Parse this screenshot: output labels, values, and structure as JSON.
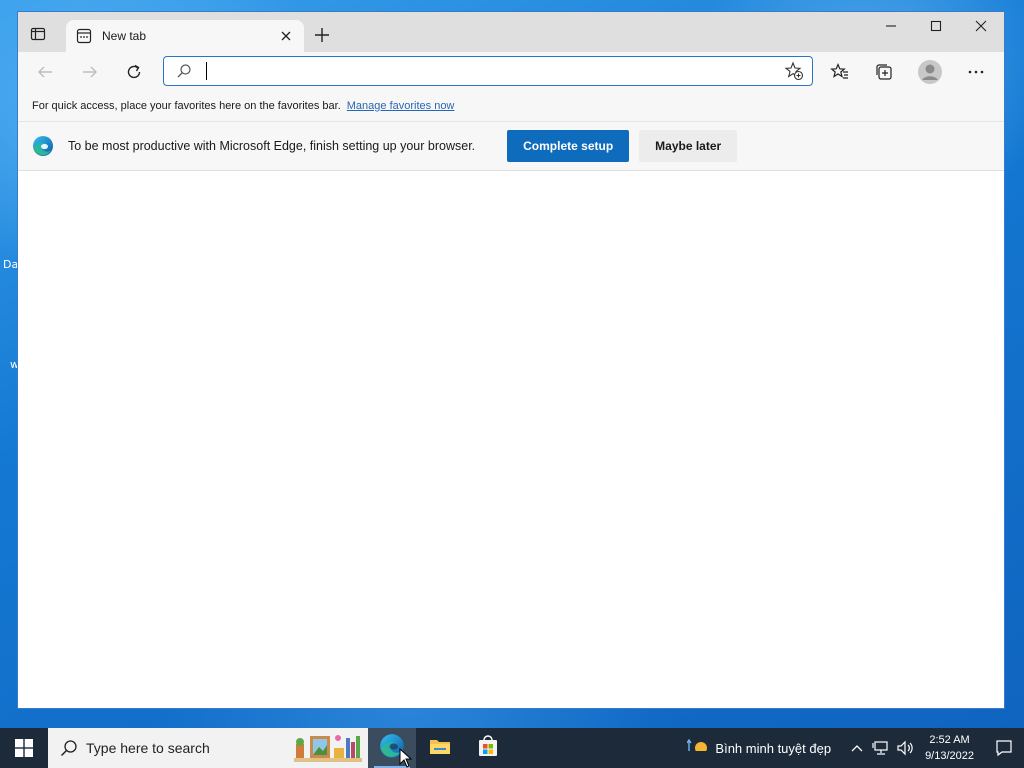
{
  "desktop": {
    "fragments": [
      "Da",
      "w"
    ]
  },
  "browser": {
    "tab": {
      "title": "New tab",
      "favicon": "newtab-page-icon"
    },
    "window_controls": {
      "minimize": "minimize-icon",
      "maximize": "maximize-icon",
      "close": "close-icon"
    },
    "toolbar": {
      "address_value": "",
      "address_placeholder": ""
    },
    "favorites_bar": {
      "text": "For quick access, place your favorites here on the favorites bar.",
      "link": "Manage favorites now"
    },
    "infobar": {
      "message": "To be most productive with Microsoft Edge, finish setting up your browser.",
      "primary_button": "Complete setup",
      "secondary_button": "Maybe later"
    }
  },
  "taskbar": {
    "search_placeholder": "Type here to search",
    "apps": [
      "edge-icon",
      "file-explorer-icon",
      "store-icon"
    ],
    "weather": "Bình minh tuyệt đẹp",
    "time": "2:52 AM",
    "date": "9/13/2022"
  },
  "colors": {
    "accent": "#0f6cbd",
    "taskbar": "#1c2a3a",
    "link": "#2867b5"
  }
}
